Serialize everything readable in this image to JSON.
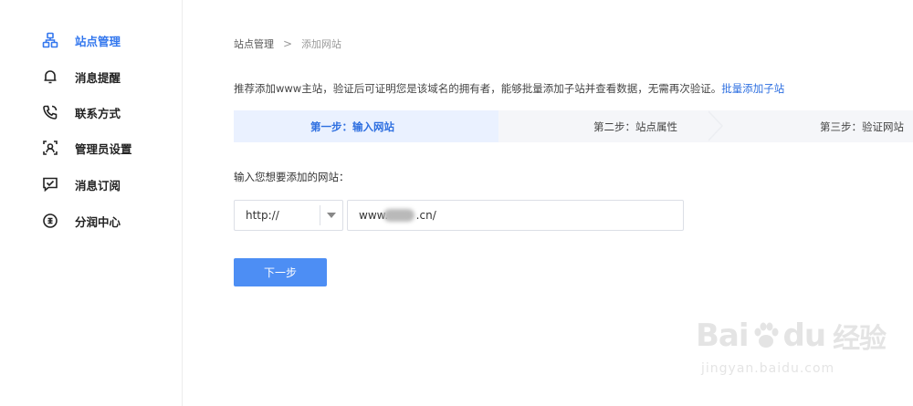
{
  "sidebar": {
    "items": [
      {
        "label": "站点管理",
        "icon": "sitemap-icon",
        "active": true
      },
      {
        "label": "消息提醒",
        "icon": "bell-icon",
        "active": false
      },
      {
        "label": "联系方式",
        "icon": "phone-icon",
        "active": false
      },
      {
        "label": "管理员设置",
        "icon": "admin-user-icon",
        "active": false
      },
      {
        "label": "消息订阅",
        "icon": "message-check-icon",
        "active": false
      },
      {
        "label": "分润中心",
        "icon": "coin-icon",
        "active": false
      }
    ]
  },
  "breadcrumb": {
    "parent": "站点管理",
    "separator": ">",
    "current": "添加网站"
  },
  "intro": {
    "text": "推荐添加www主站，验证后可证明您是该域名的拥有者，能够批量添加子站并查看数据，无需再次验证。",
    "link": "批量添加子站"
  },
  "steps": [
    {
      "label": "第一步：输入网站",
      "active": true
    },
    {
      "label": "第二步：站点属性",
      "active": false
    },
    {
      "label": "第三步：验证网站",
      "active": false
    }
  ],
  "form": {
    "prompt": "输入您想要添加的网站：",
    "protocol": "http://",
    "url_value": "www.        .cn/"
  },
  "actions": {
    "next_label": "下一步"
  },
  "watermark": {
    "brand_left": "Bai",
    "brand_right": "du",
    "brand_cn": "经验",
    "sub": "jingyan.baidu.com"
  },
  "colors": {
    "accent": "#3377ee",
    "link": "#2e6fe0",
    "button": "#4d8ef4",
    "step_active_bg": "#eaf1ff"
  }
}
